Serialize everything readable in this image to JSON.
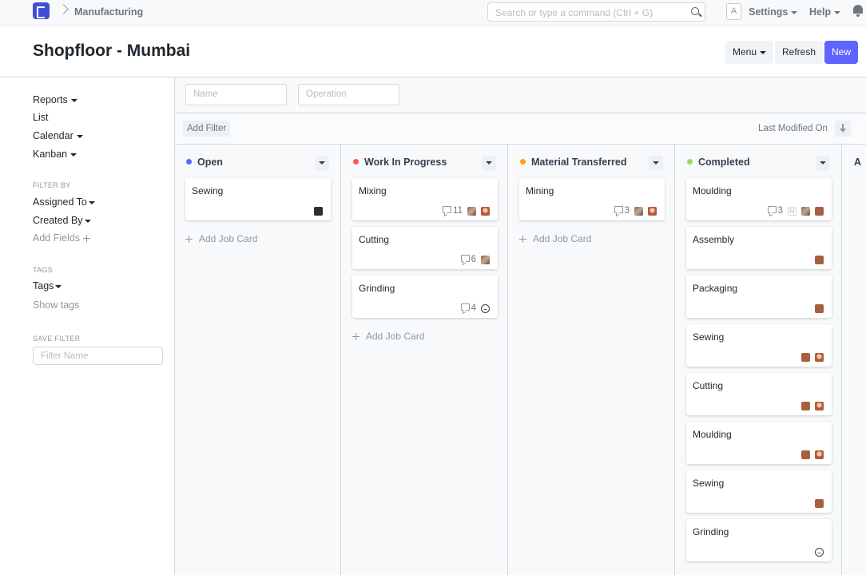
{
  "navbar": {
    "breadcrumb": "Manufacturing",
    "search_placeholder": "Search or type a command (Ctrl + G)",
    "avatar_letter": "A",
    "settings_label": "Settings",
    "help_label": "Help"
  },
  "page": {
    "title": "Shopfloor - Mumbai",
    "menu_label": "Menu",
    "refresh_label": "Refresh",
    "new_label": "New"
  },
  "sidebar": {
    "reports": "Reports",
    "list": "List",
    "calendar": "Calendar",
    "kanban": "Kanban",
    "filter_by_heading": "FILTER BY",
    "assigned_to": "Assigned To",
    "created_by": "Created By",
    "add_fields": "Add Fields",
    "tags_heading": "TAGS",
    "tags": "Tags",
    "show_tags": "Show tags",
    "save_filter_heading": "SAVE FILTER",
    "filter_name_placeholder": "Filter Name"
  },
  "filters": {
    "name_placeholder": "Name",
    "operation_placeholder": "Operation",
    "add_filter": "Add Filter",
    "sort_label": "Last Modified On"
  },
  "colors": {
    "open": "#5e64ff",
    "work_in_progress": "#ff5858",
    "material_transferred": "#ffa00a",
    "completed": "#98d85b",
    "primary": "#5e64ff"
  },
  "columns": [
    {
      "title": "Open",
      "add_label": "Add Job Card",
      "cards": [
        {
          "title": "Sewing",
          "comments": "",
          "avatars": [
            "d"
          ]
        }
      ]
    },
    {
      "title": "Work In Progress",
      "add_label": "Add Job Card",
      "cards": [
        {
          "title": "Mixing",
          "comments": "11",
          "avatars": [
            "a",
            "b"
          ]
        },
        {
          "title": "Cutting",
          "comments": "6",
          "avatars": [
            "a"
          ]
        },
        {
          "title": "Grinding",
          "comments": "4",
          "avatars": [
            "e"
          ]
        }
      ]
    },
    {
      "title": "Material Transferred",
      "add_label": "Add Job Card",
      "cards": [
        {
          "title": "Mining",
          "comments": "3",
          "avatars": [
            "a",
            "b"
          ]
        }
      ]
    },
    {
      "title": "Completed",
      "add_label": "",
      "cards": [
        {
          "title": "Moulding",
          "comments": "3",
          "avatars": [
            "m",
            "a",
            "c"
          ]
        },
        {
          "title": "Assembly",
          "comments": "",
          "avatars": [
            "c"
          ]
        },
        {
          "title": "Packaging",
          "comments": "",
          "avatars": [
            "c"
          ]
        },
        {
          "title": "Sewing",
          "comments": "",
          "avatars": [
            "c",
            "b"
          ]
        },
        {
          "title": "Cutting",
          "comments": "",
          "avatars": [
            "c",
            "b"
          ]
        },
        {
          "title": "Moulding",
          "comments": "",
          "avatars": [
            "c",
            "b"
          ]
        },
        {
          "title": "Sewing",
          "comments": "",
          "avatars": [
            "c"
          ]
        },
        {
          "title": "Grinding",
          "comments": "",
          "avatars": [
            "e"
          ]
        }
      ]
    },
    {
      "title": "A",
      "add_label": "",
      "cards": []
    }
  ]
}
